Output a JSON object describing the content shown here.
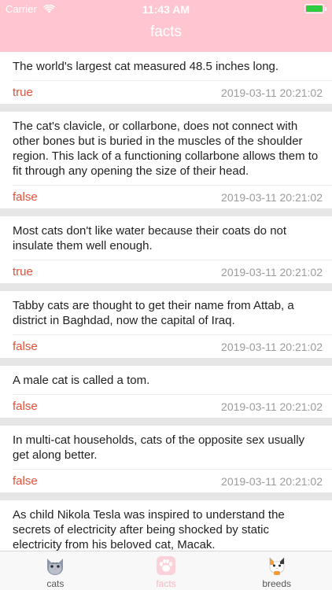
{
  "status_bar": {
    "carrier": "Carrier",
    "time": "11:43 AM"
  },
  "header": {
    "title": "facts"
  },
  "facts": [
    {
      "text": "The world's largest cat measured 48.5 inches long.",
      "verdict": "true",
      "date": "2019-03-11 20:21:02"
    },
    {
      "text": "The cat's clavicle, or collarbone, does not connect with other bones but is buried in the muscles of the shoulder region. This lack of a functioning collarbone allows them to fit through any opening the size of their head.",
      "verdict": "false",
      "date": "2019-03-11 20:21:02"
    },
    {
      "text": "Most cats don't like water because their coats do not insulate them well enough.",
      "verdict": "true",
      "date": "2019-03-11 20:21:02"
    },
    {
      "text": "Tabby cats are thought to get their name from Attab, a district in Baghdad, now the capital of Iraq.",
      "verdict": "false",
      "date": "2019-03-11 20:21:02"
    },
    {
      "text": "A male cat is called a tom.",
      "verdict": "false",
      "date": "2019-03-11 20:21:02"
    },
    {
      "text": "In multi-cat households, cats of the opposite sex usually get along better.",
      "verdict": "false",
      "date": "2019-03-11 20:21:02"
    },
    {
      "text": "As child Nikola Tesla was inspired to understand the secrets of electricity after being shocked by static electricity from his beloved cat, Macak.",
      "verdict": "",
      "date": ""
    }
  ],
  "tabbar": {
    "tabs": [
      {
        "label": "cats",
        "icon": "cat-face-icon",
        "active": false
      },
      {
        "label": "facts",
        "icon": "paw-icon",
        "active": true
      },
      {
        "label": "breeds",
        "icon": "calico-cat-icon",
        "active": false
      }
    ]
  },
  "colors": {
    "header_bg": "#ffc6d0",
    "verdict": "#e0523a",
    "active_tab": "#f9b7c3"
  }
}
